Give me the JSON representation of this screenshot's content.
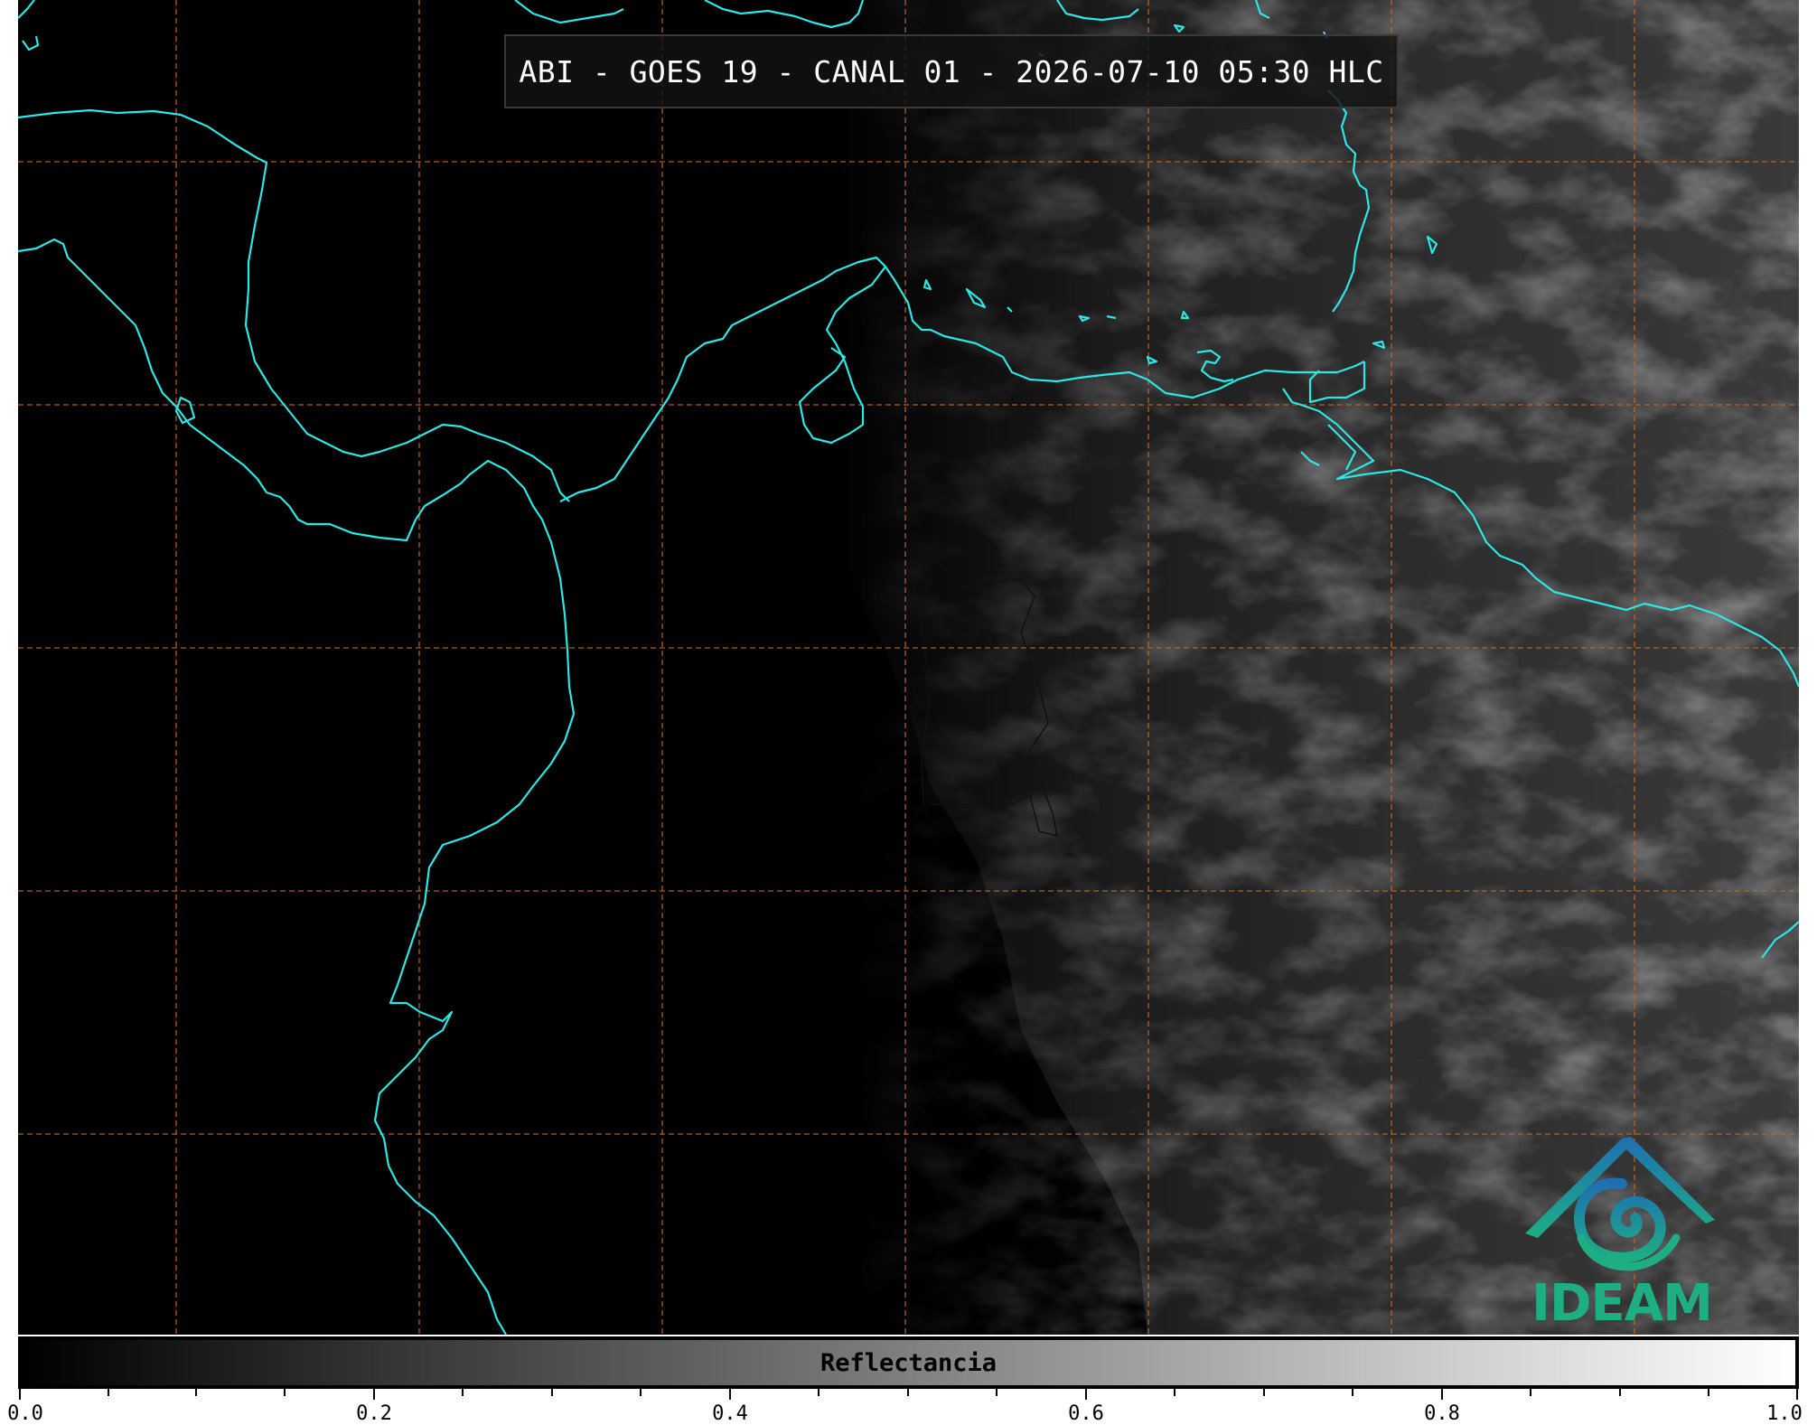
{
  "title": "ABI - GOES 19 - CANAL 01 - 2026-07-10 05:30 HLC",
  "colors": {
    "coastline": "#2ce7e4",
    "grid": "#c8641e",
    "title_bg": "#121212",
    "logo_blue": "#1f6fb2",
    "logo_green": "#1dae84"
  },
  "icons": {
    "logo": "ideam-logo-icon"
  },
  "logo_text": "IDEAM",
  "colorbar": {
    "label": "Reflectancia",
    "range": [
      0.0,
      1.0
    ],
    "colormap": "grayscale",
    "tick_labels": [
      "0.0",
      "0.2",
      "0.4",
      "0.6",
      "0.8",
      "1.0"
    ]
  }
}
